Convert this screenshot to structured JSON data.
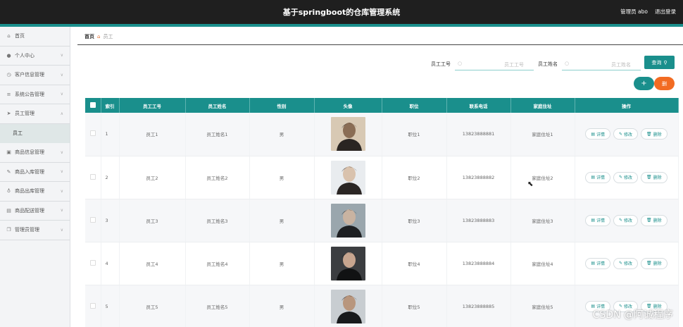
{
  "header": {
    "title": "基于springboot的仓库管理系统",
    "user_label": "管理员 abo",
    "logout_label": "退出登录"
  },
  "colors": {
    "accent": "#1a8f8c",
    "danger": "#f26b22",
    "header_bg": "#1f1f1f"
  },
  "sidebar": {
    "items": [
      {
        "label": "首页",
        "icon": "home-icon"
      },
      {
        "label": "个人中心",
        "icon": "user-icon"
      },
      {
        "label": "客户信息管理",
        "icon": "clock-icon"
      },
      {
        "label": "系统公告管理",
        "icon": "stack-icon"
      },
      {
        "label": "员工管理",
        "icon": "send-icon"
      },
      {
        "label": "员工",
        "icon": ""
      },
      {
        "label": "商品信息管理",
        "icon": "picture-icon"
      },
      {
        "label": "商品入库管理",
        "icon": "pen-icon"
      },
      {
        "label": "商品出库管理",
        "icon": "mic-icon"
      },
      {
        "label": "商品配送管理",
        "icon": "box-icon"
      },
      {
        "label": "管理员管理",
        "icon": "copy-icon"
      }
    ]
  },
  "breadcrumb": {
    "home": "首页",
    "current": "员工"
  },
  "search": {
    "field1": {
      "label": "员工工号",
      "placeholder": "员工工号"
    },
    "field2": {
      "label": "员工姓名",
      "placeholder": "员工姓名"
    },
    "query_label": "查询"
  },
  "actions": {
    "add": "+",
    "delete": "删"
  },
  "table": {
    "headers": [
      "索引",
      "员工工号",
      "员工姓名",
      "性别",
      "头像",
      "职位",
      "联系电话",
      "家庭住址",
      "操作"
    ],
    "rows": [
      {
        "index": "1",
        "id": "员工1",
        "name": "员工姓名1",
        "gender": "男",
        "position": "职位1",
        "phone": "13823888881",
        "address": "家庭住址1"
      },
      {
        "index": "2",
        "id": "员工2",
        "name": "员工姓名2",
        "gender": "男",
        "position": "职位2",
        "phone": "13823888882",
        "address": "家庭住址2"
      },
      {
        "index": "3",
        "id": "员工3",
        "name": "员工姓名3",
        "gender": "男",
        "position": "职位3",
        "phone": "13823888883",
        "address": "家庭住址3"
      },
      {
        "index": "4",
        "id": "员工4",
        "name": "员工姓名4",
        "gender": "男",
        "position": "职位4",
        "phone": "13823888884",
        "address": "家庭住址4"
      },
      {
        "index": "5",
        "id": "员工5",
        "name": "员工姓名5",
        "gender": "男",
        "position": "职位5",
        "phone": "13823888885",
        "address": "家庭住址5"
      }
    ],
    "ops": {
      "detail": "详情",
      "edit": "修改",
      "delete": "删除"
    }
  },
  "watermark": "CSDN @阿诚程序"
}
